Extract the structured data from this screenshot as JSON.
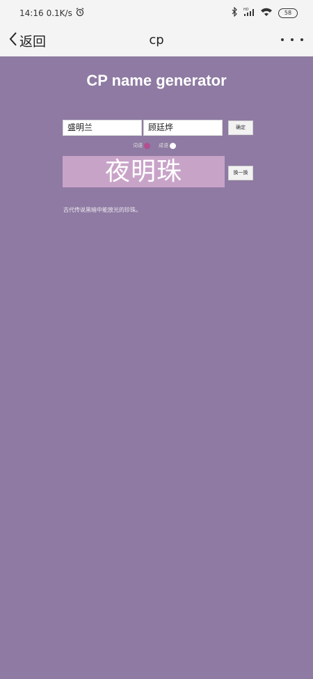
{
  "status_bar": {
    "time": "14:16",
    "speed": "0.1K/s",
    "battery": "58"
  },
  "nav": {
    "back_label": "返回",
    "title": "cp"
  },
  "main": {
    "title": "CP name generator",
    "input1_value": "盛明兰",
    "input2_value": "顾廷烨",
    "confirm_label": "确定",
    "mode_options": [
      {
        "label": "词语",
        "selected": true
      },
      {
        "label": "成语",
        "selected": false
      }
    ],
    "result": "夜明珠",
    "change_label": "换一换",
    "description": "古代传说黑暗中能放光的珍珠。"
  },
  "colors": {
    "background": "#8e7aa2",
    "result_box": "#c8a3c8",
    "radio_selected": "#b3508f"
  }
}
